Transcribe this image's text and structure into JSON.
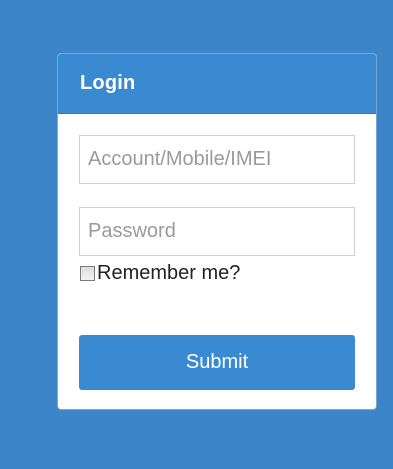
{
  "login": {
    "title": "Login",
    "account_placeholder": "Account/Mobile/IMEI",
    "account_value": "",
    "password_placeholder": "Password",
    "password_value": "",
    "remember_label": "Remember me?",
    "remember_checked": false,
    "submit_label": "Submit"
  },
  "colors": {
    "background": "#3b85c8",
    "header": "#3a8ad2",
    "button": "#3a8ad2"
  }
}
